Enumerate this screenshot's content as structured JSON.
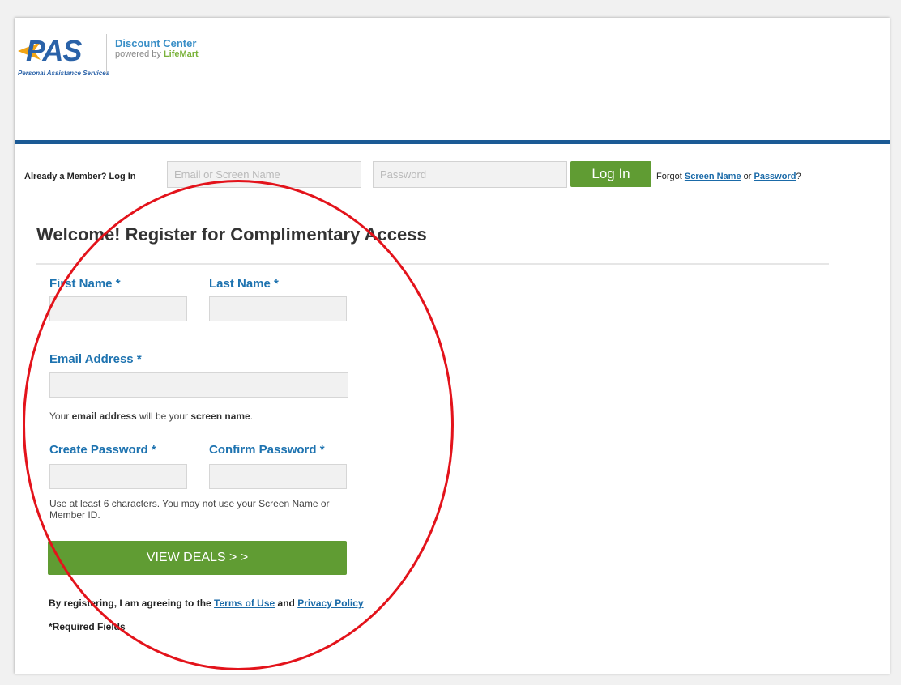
{
  "header": {
    "logo_text": "PAS",
    "logo_subtext": "Personal Assistance Services",
    "title": "Discount Center",
    "powered_by_prefix": "powered by ",
    "powered_by_brand": "LifeMart"
  },
  "login": {
    "label": "Already a Member? Log In",
    "email_placeholder": "Email or Screen Name",
    "password_placeholder": "Password",
    "button": "Log In",
    "forgot_prefix": "Forgot ",
    "forgot_screen_name": "Screen Name",
    "forgot_or": " or ",
    "forgot_password": "Password",
    "forgot_suffix": "?"
  },
  "form": {
    "title": "Welcome! Register for Complimentary Access",
    "first_name_label": "First Name *",
    "last_name_label": "Last Name *",
    "email_label": "Email Address *",
    "email_help_1": "Your ",
    "email_help_2": "email address",
    "email_help_3": " will be your ",
    "email_help_4": "screen name",
    "email_help_5": ".",
    "create_password_label": "Create Password *",
    "confirm_password_label": "Confirm Password *",
    "password_help": "Use at least 6 characters. You may not use your Screen Name or Member ID.",
    "submit": "VIEW DEALS > >",
    "agree_prefix": "By registering, I am agreeing to the ",
    "terms_link": "Terms of Use",
    "agree_and": " and ",
    "privacy_link": "Privacy Policy",
    "required_note": "*Required Fields"
  },
  "colors": {
    "brand_blue": "#1b5a95",
    "label_blue": "#1e73b0",
    "button_green": "#609c33",
    "annotation_red": "#e3131b"
  }
}
